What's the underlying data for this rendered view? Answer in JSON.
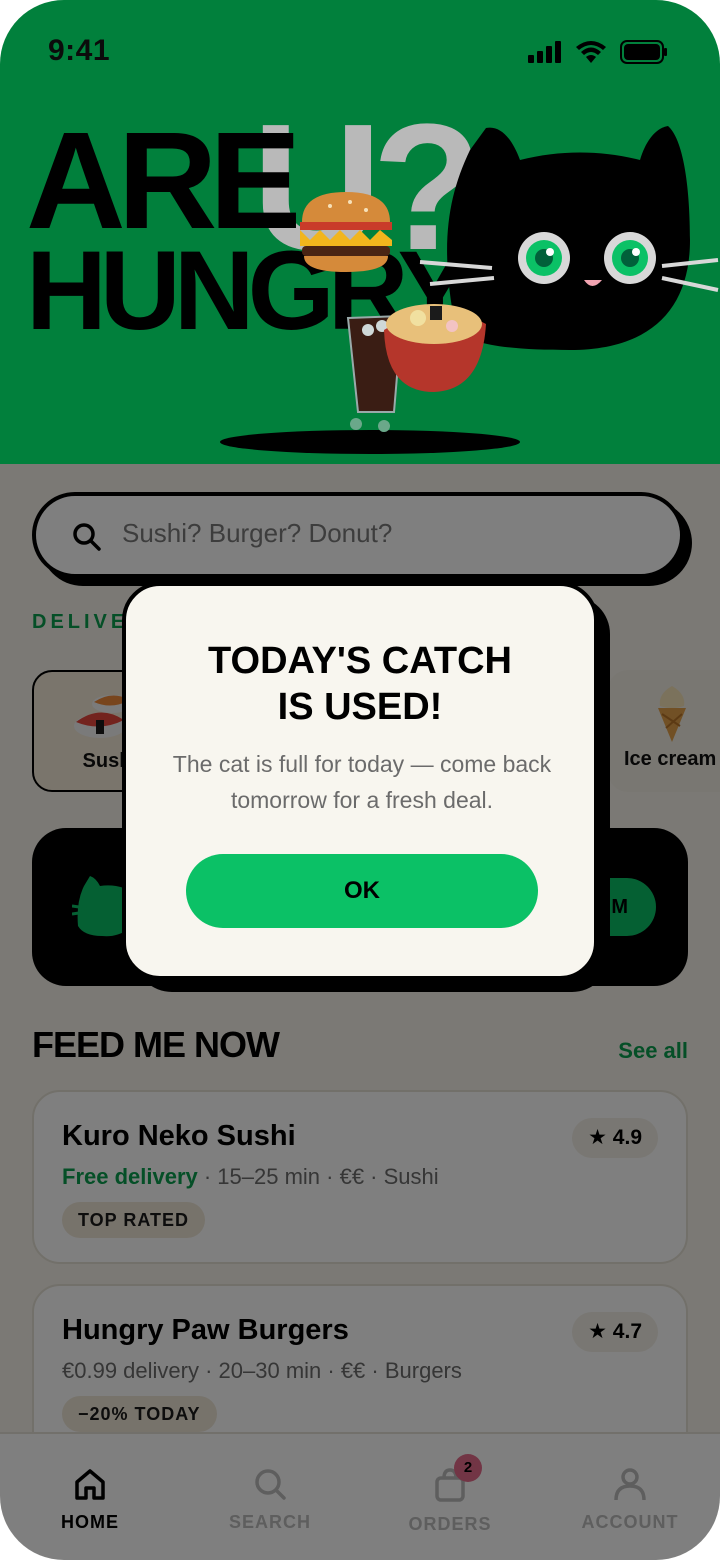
{
  "status_bar": {
    "time": "9:41"
  },
  "hero": {
    "line1": "ARE",
    "u_text": "U?",
    "line2": "HUNGRY"
  },
  "search": {
    "placeholder": "Sushi? Burger? Donut?"
  },
  "delivery_label": "DELIVE",
  "categories": [
    {
      "label": "Sush",
      "icon": "sushi-icon"
    },
    {
      "label": "Ice cream",
      "icon": "ice-cream-icon"
    }
  ],
  "promo": {
    "button_label": "IM"
  },
  "feed": {
    "title": "FEED ME NOW",
    "see_all": "See all",
    "restaurants": [
      {
        "name": "Kuro Neko Sushi",
        "delivery": "Free delivery",
        "meta": " · 15–25 min · €€ · Sushi",
        "rating": "★ 4.9",
        "tag": "TOP RATED"
      },
      {
        "name": "Hungry Paw Burgers",
        "delivery": "€0.99 delivery",
        "meta": " · 20–30 min · €€ · Burgers",
        "rating": "★ 4.7",
        "tag": "−20% TODAY"
      }
    ]
  },
  "tabbar": {
    "tabs": [
      {
        "label": "HOME",
        "icon": "home-icon"
      },
      {
        "label": "SEARCH",
        "icon": "search-icon"
      },
      {
        "label": "ORDERS",
        "icon": "bag-icon",
        "badge": "2"
      },
      {
        "label": "ACCOUNT",
        "icon": "user-icon"
      }
    ]
  },
  "modal": {
    "title_line1": "TODAY'S CATCH",
    "title_line2": "IS USED!",
    "body": "The cat is full for today — come back tomorrow for a fresh deal.",
    "ok_label": "OK"
  },
  "colors": {
    "brand_green": "#01803c",
    "accent_green": "#0bc166",
    "link_green": "#0a9f4f",
    "badge_pink": "#e56b8a"
  }
}
